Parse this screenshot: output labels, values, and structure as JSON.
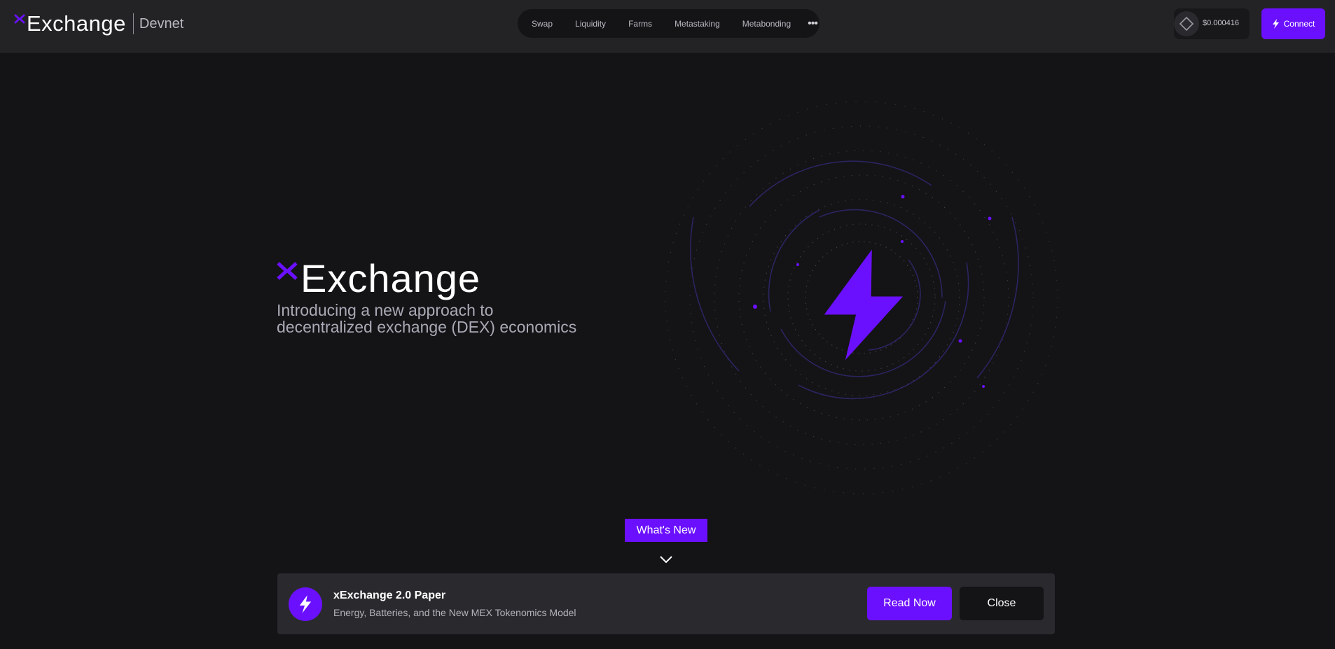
{
  "header": {
    "brand": "Exchange",
    "network": "Devnet",
    "nav": [
      {
        "label": "Swap"
      },
      {
        "label": "Liquidity"
      },
      {
        "label": "Farms"
      },
      {
        "label": "Metastaking"
      },
      {
        "label": "Metabonding"
      }
    ],
    "more_icon": "ellipsis-icon",
    "token_price": "$0.000416",
    "token_icon": "diamond-icon",
    "connect_label": "Connect",
    "connect_icon": "lightning-icon"
  },
  "hero": {
    "logo_word": "Exchange",
    "subtitle_line1": "Introducing a new approach to",
    "subtitle_line2": "decentralized exchange (DEX) economics",
    "art_icon": "lightning-icon"
  },
  "whats_new": {
    "label": "What's New",
    "chevron_icon": "chevron-down-icon"
  },
  "announcement": {
    "icon": "lightning-icon",
    "title": "xExchange 2.0 Paper",
    "description": "Energy, Batteries, and the New MEX Tokenomics Model",
    "read_label": "Read Now",
    "close_label": "Close"
  },
  "colors": {
    "accent": "#6b10ff",
    "background": "#141316",
    "header": "#232326",
    "card": "#2a2a2e"
  }
}
